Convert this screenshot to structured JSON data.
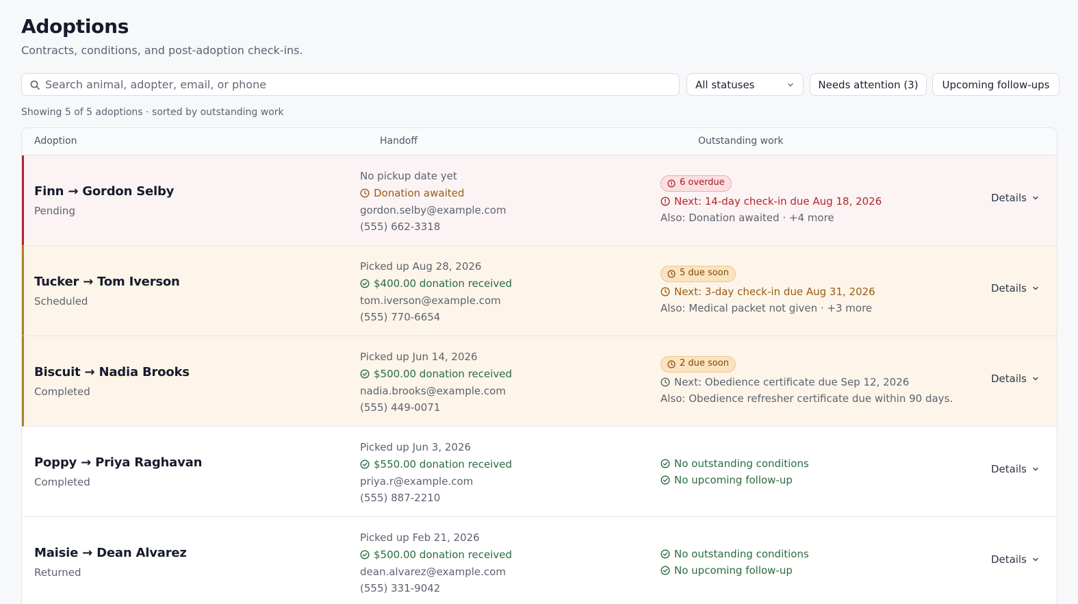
{
  "header": {
    "title": "Adoptions",
    "subtitle": "Contracts, conditions, and post-adoption check-ins."
  },
  "toolbar": {
    "search_placeholder": "Search animal, adopter, email, or phone",
    "status_select": "All statuses",
    "needs_attention": "Needs attention (3)",
    "upcoming_followups": "Upcoming follow-ups"
  },
  "meta": "Showing 5 of 5 adoptions · sorted by outstanding work",
  "columns": {
    "adoption": "Adoption",
    "handoff": "Handoff",
    "outstanding": "Outstanding work"
  },
  "colors": {
    "overdue": "#b4232c",
    "due_soon": "#b07d2c",
    "ok": "#2a6b3f"
  },
  "rows": [
    {
      "name": "Finn → Gordon Selby",
      "status": "Pending",
      "pickup": "No pickup date yet",
      "donation": "Donation awaited",
      "email": "gordon.selby@example.com",
      "phone": "(555) 662-3318",
      "badge": "6 overdue",
      "next": "Next: 14-day check-in due Aug 18, 2026",
      "also": "Also: Donation awaited · +4 more",
      "details": "Details"
    },
    {
      "name": "Tucker → Tom Iverson",
      "status": "Scheduled",
      "pickup": "Picked up Aug 28, 2026",
      "donation": "$400.00 donation received",
      "email": "tom.iverson@example.com",
      "phone": "(555) 770-6654",
      "badge": "5 due soon",
      "next": "Next: 3-day check-in due Aug 31, 2026",
      "also": "Also: Medical packet not given · +3 more",
      "details": "Details"
    },
    {
      "name": "Biscuit → Nadia Brooks",
      "status": "Completed",
      "pickup": "Picked up Jun 14, 2026",
      "donation": "$500.00 donation received",
      "email": "nadia.brooks@example.com",
      "phone": "(555) 449-0071",
      "badge": "2 due soon",
      "next": "Next: Obedience certificate due Sep 12, 2026",
      "also": "Also: Obedience refresher certificate due within 90 days.",
      "details": "Details"
    },
    {
      "name": "Poppy → Priya Raghavan",
      "status": "Completed",
      "pickup": "Picked up Jun 3, 2026",
      "donation": "$550.00 donation received",
      "email": "priya.r@example.com",
      "phone": "(555) 887-2210",
      "ok1": "No outstanding conditions",
      "ok2": "No upcoming follow-up",
      "details": "Details"
    },
    {
      "name": "Maisie → Dean Alvarez",
      "status": "Returned",
      "pickup": "Picked up Feb 21, 2026",
      "donation": "$500.00 donation received",
      "email": "dean.alvarez@example.com",
      "phone": "(555) 331-9042",
      "ok1": "No outstanding conditions",
      "ok2": "No upcoming follow-up",
      "details": "Details"
    }
  ]
}
